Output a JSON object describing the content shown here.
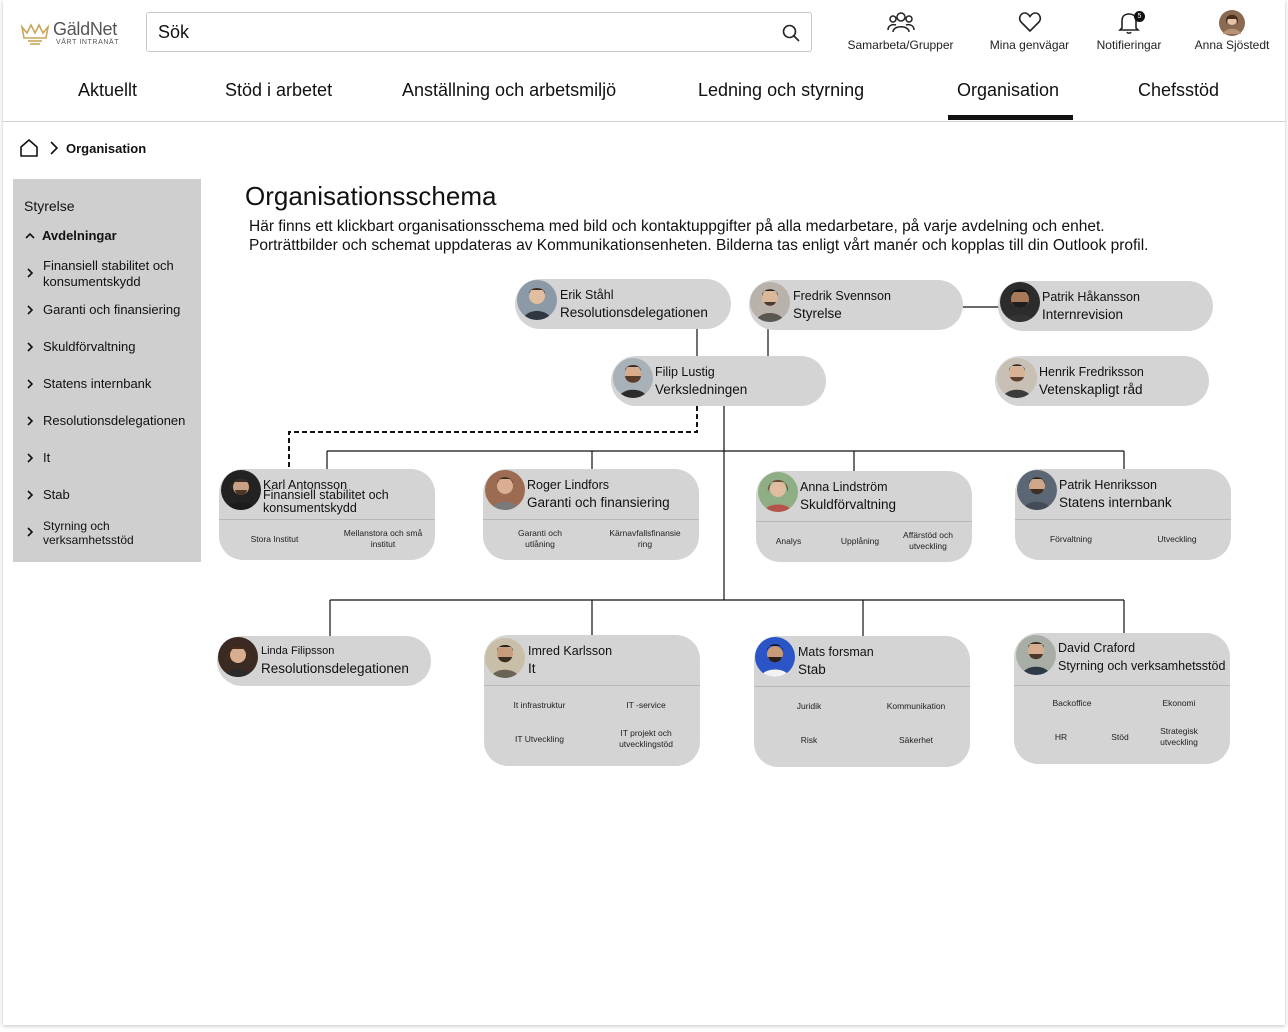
{
  "header": {
    "logo_name": "GäldNet",
    "logo_sub": "VÅRT INTRANÄT",
    "search_placeholder": "Sök",
    "items": [
      {
        "label": "Samarbeta/Grupper",
        "icon": "people-icon"
      },
      {
        "label": "Mina genvägar",
        "icon": "heart-icon"
      },
      {
        "label": "Notifieringar",
        "icon": "bell-icon",
        "badge": "5"
      },
      {
        "label": "Anna Sjöstedt",
        "icon": "avatar"
      }
    ]
  },
  "nav": {
    "items": [
      "Aktuellt",
      "Stöd i arbetet",
      "Anställning och arbetsmiljö",
      "Ledning och styrning",
      "Organisation",
      "Chefsstöd"
    ],
    "active": "Organisation"
  },
  "breadcrumb": {
    "current": "Organisation"
  },
  "sidebar": {
    "top": "Styrelse",
    "section": "Avdelningar",
    "items": [
      "Finansiell stabilitet och konsumentskydd",
      "Garanti och finansiering",
      "Skuldförvaltning",
      "Statens internbank",
      "Resolutionsdelegationen",
      "It",
      "Stab",
      "Styrning och verksamhetsstöd"
    ]
  },
  "main": {
    "title": "Organisationsschema",
    "desc1": "Här finns ett klickbart organisationsschema med bild och kontaktuppgifter på alla medarbetare, på varje avdelning och enhet.",
    "desc2": "Porträttbilder och schemat uppdateras av Kommunikationsenheten. Bilderna tas enligt vårt manér och kopplas till din Outlook profil."
  },
  "org": {
    "erik": {
      "name": "Erik Ståhl",
      "role": "Resolutionsdelegationen"
    },
    "fredrik": {
      "name": "Fredrik Svennson",
      "role": "Styrelse"
    },
    "patrikh": {
      "name": "Patrik Håkansson",
      "role": "Internrevision"
    },
    "filip": {
      "name": "Filip Lustig",
      "role": "Verksledningen"
    },
    "henrik": {
      "name": "Henrik Fredriksson",
      "role": "Vetenskapligt råd"
    },
    "karl": {
      "name": "Karl Antonsson",
      "role": "Finansiell stabilitet och konsumentskydd",
      "units": [
        "Stora Institut",
        "Mellanstora och små institut"
      ]
    },
    "roger": {
      "name": "Roger Lindfors",
      "role": "Garanti och finansiering",
      "units": [
        "Garanti och utlåning",
        "Kärnavfallsfinansiering"
      ]
    },
    "anna": {
      "name": "Anna Lindström",
      "role": "Skuldförvaltning",
      "units": [
        "Analys",
        "Upplåning",
        "Affärstöd och utveckling"
      ]
    },
    "patrik": {
      "name": "Patrik Henriksson",
      "role": "Statens internbank",
      "units": [
        "Förvaltning",
        "Utveckling"
      ]
    },
    "linda": {
      "name": "Linda Filipsson",
      "role": "Resolutionsdelegationen"
    },
    "imred": {
      "name": "Imred Karlsson",
      "role": "It",
      "units": [
        "It infrastruktur",
        "IT -service",
        "IT Utveckling",
        "IT projekt och utvecklingstöd"
      ]
    },
    "mats": {
      "name": "Mats forsman",
      "role": "Stab",
      "units": [
        "Juridik",
        "Kommunikation",
        "Risk",
        "Säkerhet"
      ]
    },
    "david": {
      "name": "David Craford",
      "role": "Styrning och verksamhetsstöd",
      "units": [
        "Backoffice",
        "Ekonomi",
        "HR",
        "Stöd",
        "Strategisk utveckling"
      ]
    }
  },
  "colors": {
    "card": "#d4d4d4",
    "sidebar": "#cfcfcf",
    "text": "#111111",
    "logo_gold": "#c9a55a"
  }
}
